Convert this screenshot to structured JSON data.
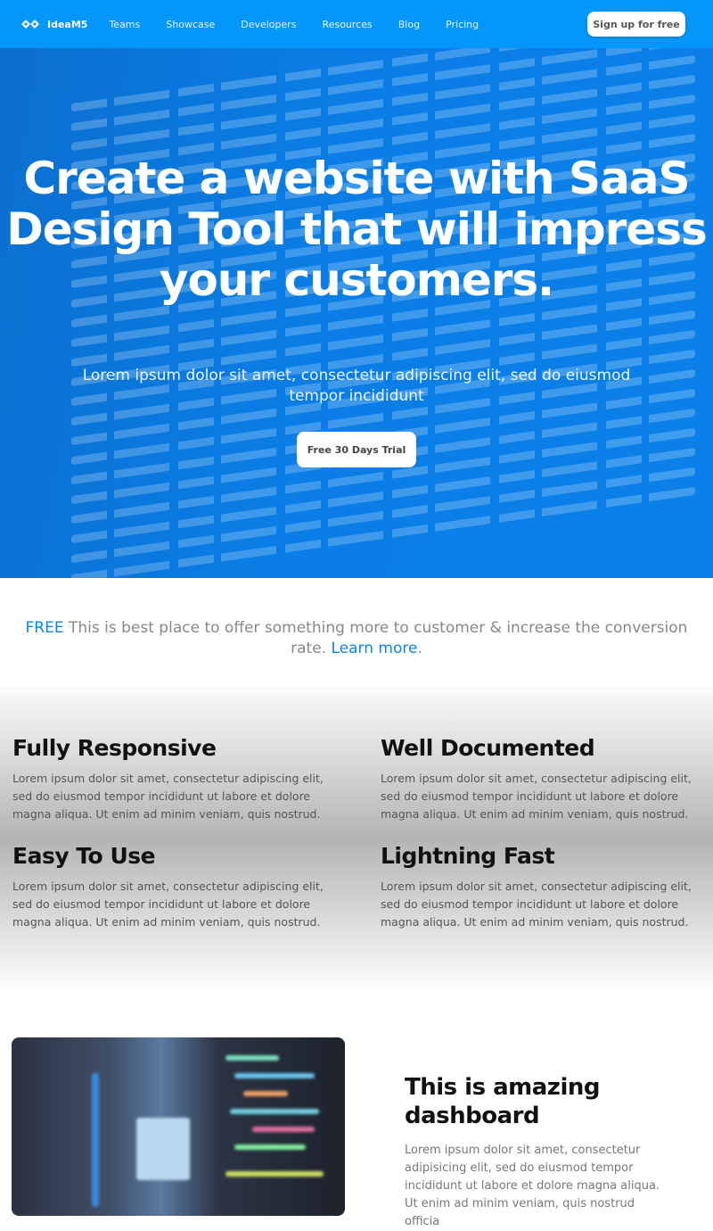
{
  "nav": {
    "brand": "IdeaM5",
    "items": [
      "Teams",
      "Showcase",
      "Developers",
      "Resources",
      "Blog",
      "Pricing"
    ],
    "signup": "Sign up for free"
  },
  "hero": {
    "title": "Create a website with SaaS Design Tool that will impress your customers.",
    "subtitle": "Lorem ipsum dolor sit amet, consectetur adipiscing elit, sed do eiusmod tempor incididunt",
    "cta": "Free 30 Days Trial"
  },
  "promo": {
    "badge": "FREE",
    "text": " This is best place to offer something more to customer & increase the conversion rate. ",
    "link": "Learn more",
    "end": "."
  },
  "features": [
    {
      "title": "Fully Responsive",
      "text": "Lorem ipsum dolor sit amet, consectetur adipiscing elit, sed do eiusmod tempor incididunt ut labore et dolore magna aliqua. Ut enim ad minim veniam, quis nostrud."
    },
    {
      "title": "Well Documented",
      "text": "Lorem ipsum dolor sit amet, consectetur adipiscing elit, sed do eiusmod tempor incididunt ut labore et dolore magna aliqua. Ut enim ad minim veniam, quis nostrud."
    },
    {
      "title": "Easy To Use",
      "text": "Lorem ipsum dolor sit amet, consectetur adipiscing elit, sed do eiusmod tempor incididunt ut labore et dolore magna aliqua. Ut enim ad minim veniam, quis nostrud."
    },
    {
      "title": "Lightning Fast",
      "text": "Lorem ipsum dolor sit amet, consectetur adipiscing elit, sed do eiusmod tempor incididunt ut labore et dolore magna aliqua. Ut enim ad minim veniam, quis nostrud."
    }
  ],
  "dashboard": {
    "title": "This is amazing dashboard",
    "text": "Lorem ipsum dolor sit amet, consectetur adipisicing elit, sed do eiusmod tempor incididunt ut labore et dolore magna aliqua. Ut enim ad minim veniam, quis nostrud officia"
  },
  "colors": {
    "nav": "#0397fb",
    "hero": "#0a7ee6",
    "accent": "#0a86e8"
  }
}
